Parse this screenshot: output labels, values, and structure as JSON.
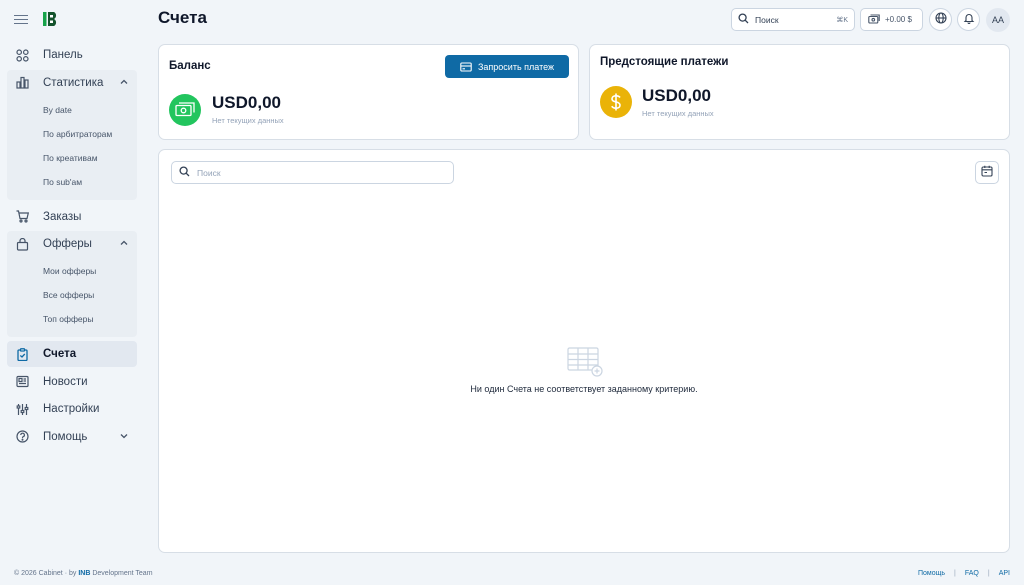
{
  "sidebar": {
    "nav": {
      "dashboard": "Панель",
      "statistics": "Статистика",
      "statistics_sub": [
        "By date",
        "По арбитраторам",
        "По креативам",
        "По sub'ам"
      ],
      "orders": "Заказы",
      "offers": "Офферы",
      "offers_sub": [
        "Мои офферы",
        "Все офферы",
        "Топ офферы"
      ],
      "invoices": "Счета",
      "news": "Новости",
      "settings": "Настройки",
      "help": "Помощь"
    }
  },
  "header": {
    "title": "Счета",
    "search_label": "Поиск",
    "search_shortcut": "⌘K",
    "balance_chip": "+0.00 $",
    "avatar_initials": "AA"
  },
  "balance_card": {
    "title": "Баланс",
    "request_button": "Запросить платеж",
    "amount": "USD0,00",
    "note": "Нет текущих данных"
  },
  "upcoming_card": {
    "title": "Предстоящие платежи",
    "amount": "USD0,00",
    "note": "Нет текущих данных"
  },
  "table": {
    "search_placeholder": "Поиск",
    "empty_message": "Ни один Счета не соответствует заданному критерию."
  },
  "footer": {
    "copyright_prefix": "© 2026 Cabinet · by",
    "brand": "INB",
    "copyright_suffix": "Development Team",
    "links": [
      "Помощь",
      "FAQ",
      "API"
    ]
  },
  "colors": {
    "accent": "#0f6aa5",
    "success": "#22c55e",
    "warning": "#eab308"
  }
}
